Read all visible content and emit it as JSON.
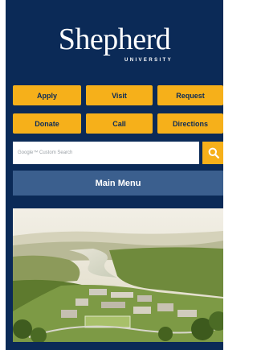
{
  "header": {
    "logo_word": "Shepherd",
    "logo_sub": "UNIVERSITY"
  },
  "quick_links": [
    {
      "label": "Apply"
    },
    {
      "label": "Visit"
    },
    {
      "label": "Request"
    },
    {
      "label": "Donate"
    },
    {
      "label": "Call"
    },
    {
      "label": "Directions"
    }
  ],
  "search": {
    "placeholder": "Google™ Custom Search",
    "button_icon": "search-icon"
  },
  "menu": {
    "label": "Main Menu"
  },
  "hero": {
    "image_icon": "campus-aerial-photo"
  },
  "colors": {
    "navy": "#0b2a57",
    "gold": "#f6b01a",
    "menu_blue": "#3b5f8e"
  }
}
